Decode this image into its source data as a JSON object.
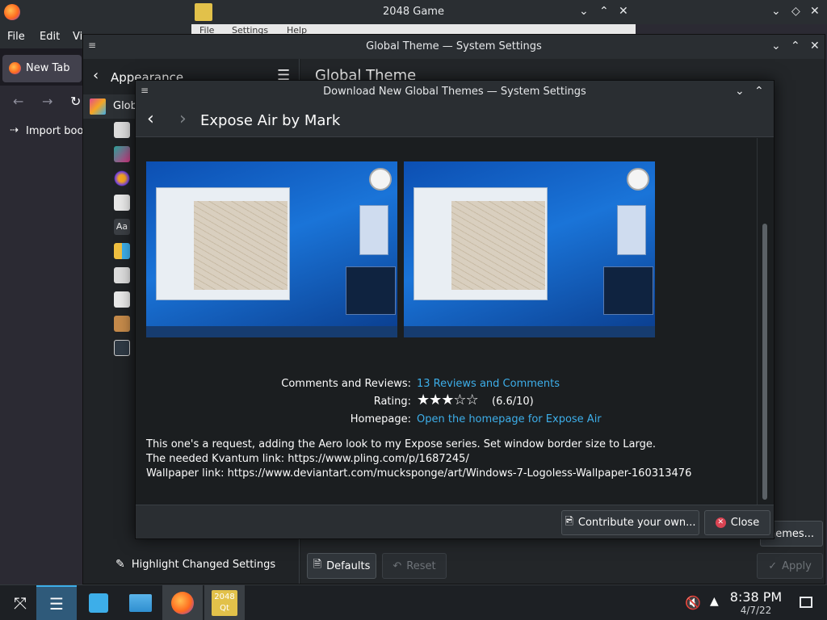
{
  "firefox": {
    "menu": [
      "File",
      "Edit",
      "Vi"
    ],
    "tab_label": "New Tab",
    "bookmark_label": "Import boo"
  },
  "game": {
    "title": "2048 Game",
    "menu": [
      "File",
      "Settings",
      "Help"
    ]
  },
  "settings": {
    "title": "Global Theme — System Settings",
    "sidebar_title": "Appearance",
    "sidebar_item": "Glob",
    "main_title": "Global Theme",
    "highlight_label": "Highlight Changed Settings",
    "defaults_label": "Defaults",
    "reset_label": "Reset",
    "apply_label": "Apply",
    "get_new_label": "hemes..."
  },
  "dialog": {
    "title": "Download New Global Themes — System Settings",
    "page_title": "Expose Air by Mark",
    "comments_label": "Comments and Reviews:",
    "comments_value": "13 Reviews and Comments",
    "rating_label": "Rating:",
    "rating_value": "(6.6/10)",
    "rating_stars": 3.3,
    "homepage_label": "Homepage:",
    "homepage_value": "Open the homepage for Expose Air",
    "description": [
      "This one's a request, adding the Aero look to my Expose series. Set window border size to Large.",
      "The needed Kvantum link: https://www.pling.com/p/1687245/",
      "Wallpaper link: https://www.deviantart.com/mucksponge/art/Windows-7-Logoless-Wallpaper-160313476"
    ],
    "contribute_label": "Contribute your own...",
    "close_label": "Close"
  },
  "taskbar": {
    "time": "8:38 PM",
    "date": "4/7/22",
    "app_2048_label": "2048"
  },
  "colors": {
    "accent": "#3daee9",
    "close_red": "#da4453"
  }
}
